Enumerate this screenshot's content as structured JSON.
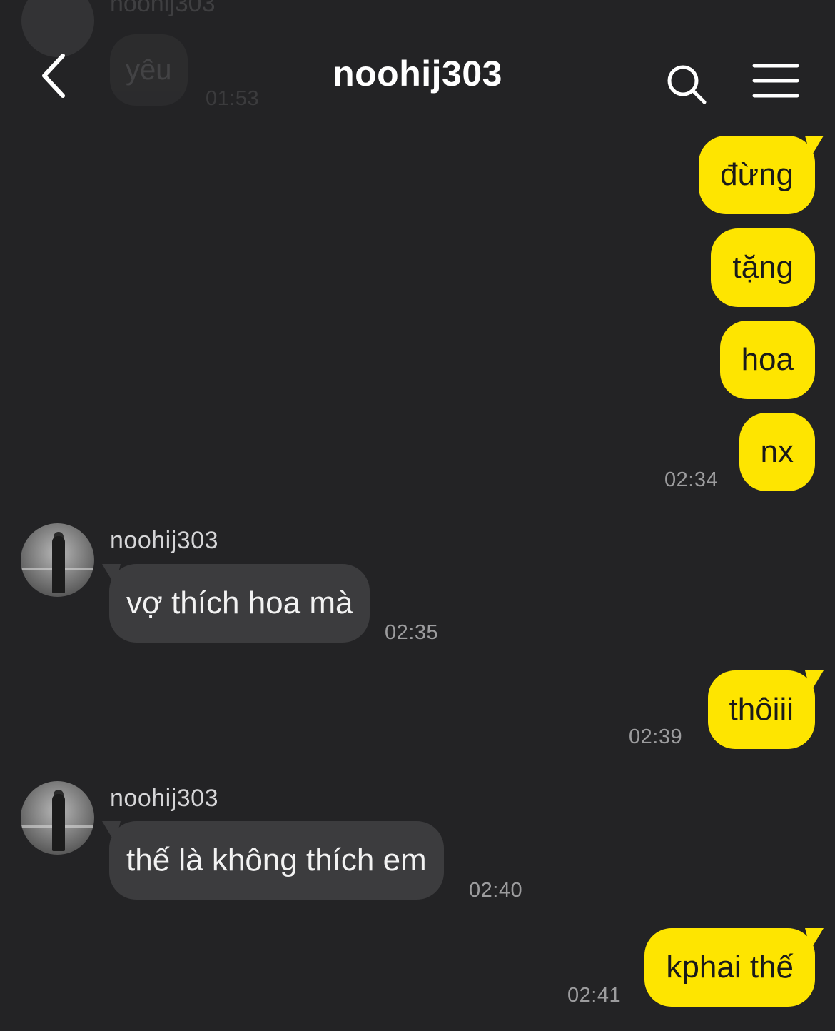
{
  "header": {
    "title": "noohij303",
    "back_icon": "chevron-left-icon",
    "search_icon": "search-icon",
    "menu_icon": "hamburger-menu-icon"
  },
  "previous_message": {
    "sender": "noohij303",
    "text": "yêu",
    "time": "01:53"
  },
  "messages": [
    {
      "from": "me",
      "text": "đừng"
    },
    {
      "from": "me",
      "text": "tặng"
    },
    {
      "from": "me",
      "text": "hoa"
    },
    {
      "from": "me",
      "text": "nx",
      "time": "02:34"
    },
    {
      "from": "them",
      "sender": "noohij303",
      "text": "vợ thích hoa mà",
      "time": "02:35"
    },
    {
      "from": "me",
      "text": "thôiii",
      "time": "02:39"
    },
    {
      "from": "them",
      "sender": "noohij303",
      "text": "thế là không thích em",
      "time": "02:40"
    },
    {
      "from": "me",
      "text": "kphai thế",
      "time": "02:41"
    }
  ],
  "colors": {
    "background": "#232325",
    "my_bubble": "#fee500",
    "their_bubble": "#3c3c3e",
    "timestamp": "#9c9c9e"
  }
}
